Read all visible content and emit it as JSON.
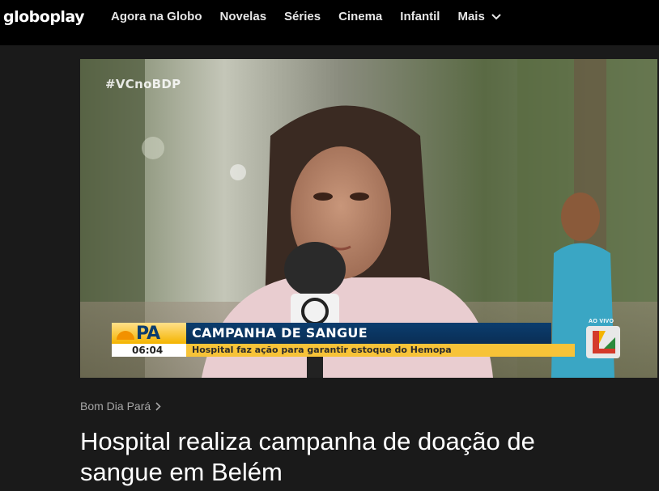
{
  "header": {
    "logo": "globoplay",
    "nav": [
      {
        "label": "Agora na Globo"
      },
      {
        "label": "Novelas"
      },
      {
        "label": "Séries"
      },
      {
        "label": "Cinema"
      },
      {
        "label": "Infantil"
      },
      {
        "label": "Mais"
      }
    ]
  },
  "video": {
    "hashtag": "#VCnoBDP",
    "program_logo": "PA",
    "time": "06:04",
    "headline": "CAMPANHA DE SANGUE",
    "subline": "Hospital  faz ação para garantir estoque do Hemopa",
    "live": "AO VIVO"
  },
  "breadcrumb": {
    "label": "Bom Dia Pará"
  },
  "article": {
    "title": "Hospital realiza campanha de doação de sangue em Belém"
  },
  "colors": {
    "background": "#1a1a1a",
    "nav_bg": "#000000",
    "banner_blue": "#0b3d6e",
    "banner_yellow": "#f7c338"
  }
}
